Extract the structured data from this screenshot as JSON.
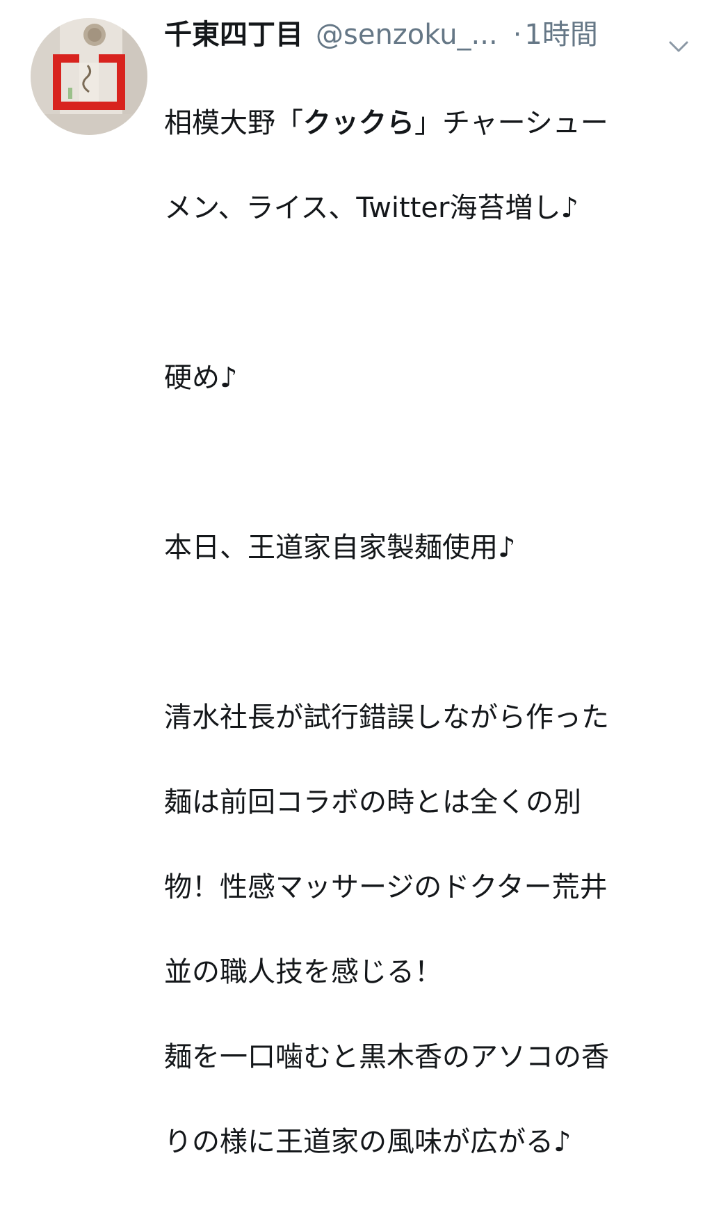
{
  "tweet": {
    "display_name": "千東四丁目",
    "handle": "@senzoku_...",
    "separator": "·",
    "time": "1時間",
    "avatar_icon": "profile-avatar-photo",
    "menu_icon": "chevron-down-icon",
    "text": {
      "l1_a": "相模大野「",
      "l1_b": "クックら",
      "l1_c": "」チャーシュー",
      "l2": "メン、ライス、Twitter海苔増し♪",
      "l3": "硬め♪",
      "l4": "本日、王道家自家製麺使用♪",
      "l5": "清水社長が試行錯誤しながら作った",
      "l6": "麺は前回コラボの時とは全くの別",
      "l7": "物！性感マッサージのドクター荒井",
      "l8": "並の職人技を感じる！",
      "l9": "麺を一口噛むと黒木香のアソコの香",
      "l10": "りの様に王道家の風味が広がる♪"
    }
  }
}
